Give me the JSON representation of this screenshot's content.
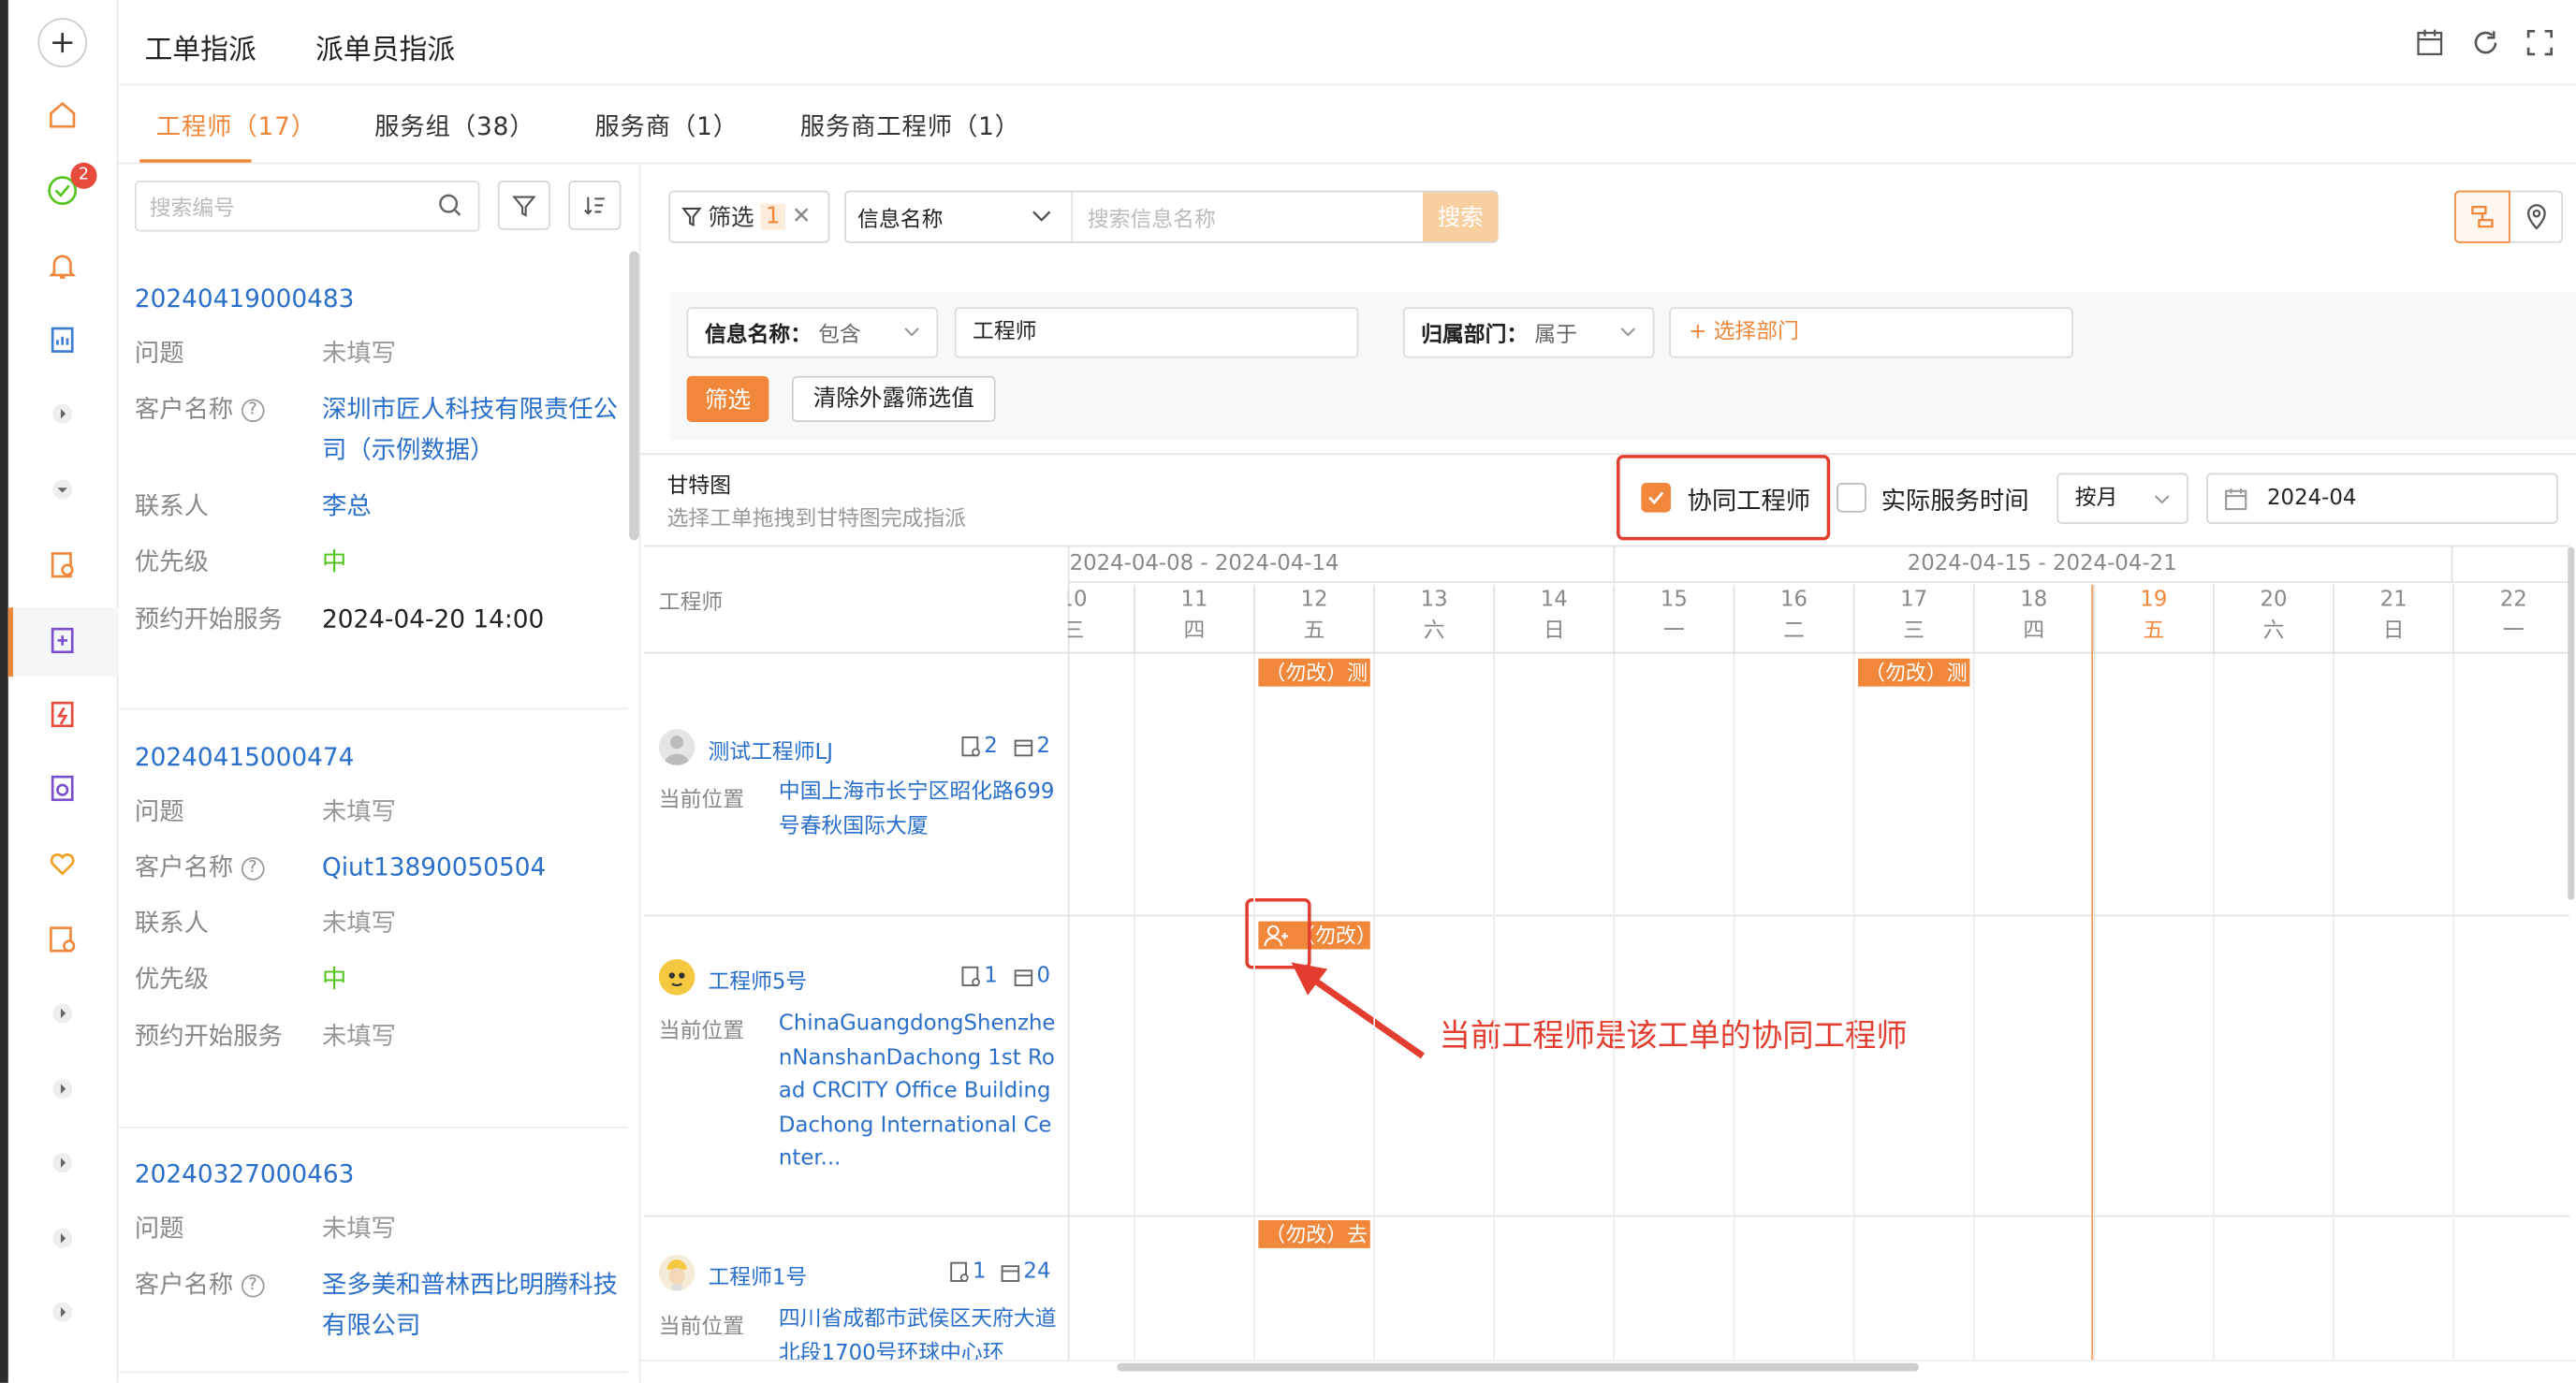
{
  "nav_tabs": {
    "dispatch": "工单指派",
    "dispatcher": "派单员指派"
  },
  "tabs": [
    "工程师（17）",
    "服务组（38）",
    "服务商（1）",
    "服务商工程师（1）"
  ],
  "rail": {
    "badge": "2"
  },
  "list": {
    "search_placeholder": "搜索编号",
    "cards": [
      {
        "no": "20240419000483",
        "rows": [
          {
            "label": "问题",
            "value": "未填写"
          },
          {
            "label": "客户名称",
            "value": "深圳市匠人科技有限责任公司（示例数据）"
          },
          {
            "label": "联系人",
            "value": "李总"
          },
          {
            "label": "优先级",
            "value": "中"
          },
          {
            "label": "预约开始服务",
            "value": "2024-04-20 14:00"
          }
        ]
      },
      {
        "no": "20240415000474",
        "rows": [
          {
            "label": "问题",
            "value": "未填写"
          },
          {
            "label": "客户名称",
            "value": "Qiut13890050504"
          },
          {
            "label": "联系人",
            "value": "未填写"
          },
          {
            "label": "优先级",
            "value": "中"
          },
          {
            "label": "预约开始服务",
            "value": "未填写"
          }
        ]
      },
      {
        "no": "20240327000463",
        "rows": [
          {
            "label": "问题",
            "value": "未填写"
          },
          {
            "label": "客户名称",
            "value": "圣多美和普林西比明腾科技有限公司"
          }
        ]
      }
    ]
  },
  "toolbar": {
    "filter_label": "筛选",
    "filter_count": "1",
    "field_select": "信息名称",
    "search_placeholder": "搜索信息名称",
    "search_button": "搜索"
  },
  "filters": {
    "f1_label": "信息名称：",
    "f1_op": "包含",
    "f1_value": "工程师",
    "f2_label": "归属部门：",
    "f2_op": "属于",
    "f2_value": "+ 选择部门",
    "apply": "筛选",
    "clear": "清除外露筛选值"
  },
  "gantt": {
    "title": "甘特图",
    "subtitle": "选择工单拖拽到甘特图完成指派",
    "co_engineer_label": "协同工程师",
    "co_engineer_checked": true,
    "actual_time_label": "实际服务时间",
    "period": "按月",
    "month": "2024-04",
    "engineer_col": "工程师",
    "weeks": [
      "2024-04-08 - 2024-04-14",
      "2024-04-15 - 2024-04-21"
    ],
    "days": [
      {
        "d": "10",
        "w": "三"
      },
      {
        "d": "11",
        "w": "四"
      },
      {
        "d": "12",
        "w": "五"
      },
      {
        "d": "13",
        "w": "六"
      },
      {
        "d": "14",
        "w": "日"
      },
      {
        "d": "15",
        "w": "一"
      },
      {
        "d": "16",
        "w": "二"
      },
      {
        "d": "17",
        "w": "三"
      },
      {
        "d": "18",
        "w": "四"
      },
      {
        "d": "19",
        "w": "五"
      },
      {
        "d": "20",
        "w": "六"
      },
      {
        "d": "21",
        "w": "日"
      },
      {
        "d": "22",
        "w": "一"
      }
    ],
    "today": "19",
    "addr_label": "当前位置",
    "engineers": [
      {
        "name": "测试工程师LJ",
        "orders": "2",
        "events": "2",
        "address": "中国上海市长宁区昭化路699号春秋国际大厦"
      },
      {
        "name": "工程师5号",
        "orders": "1",
        "events": "0",
        "address": "ChinaGuangdongShenzhenNanshanDachong 1st Road CRCITY Office Building Dachong International Center..."
      },
      {
        "name": "工程师1号",
        "orders": "1",
        "events": "24",
        "address": "四川省成都市武侯区天府大道北段1700号环球中心环"
      }
    ],
    "bars": [
      "（勿改）测",
      "（勿改）测",
      "（勿改）",
      "（勿改）去"
    ]
  },
  "annotation": "当前工程师是该工单的协同工程师",
  "colors": {
    "accent": "#f0873a",
    "link": "#2a6fc9",
    "annotation": "#e33d2f",
    "priority": "#52c41a"
  }
}
